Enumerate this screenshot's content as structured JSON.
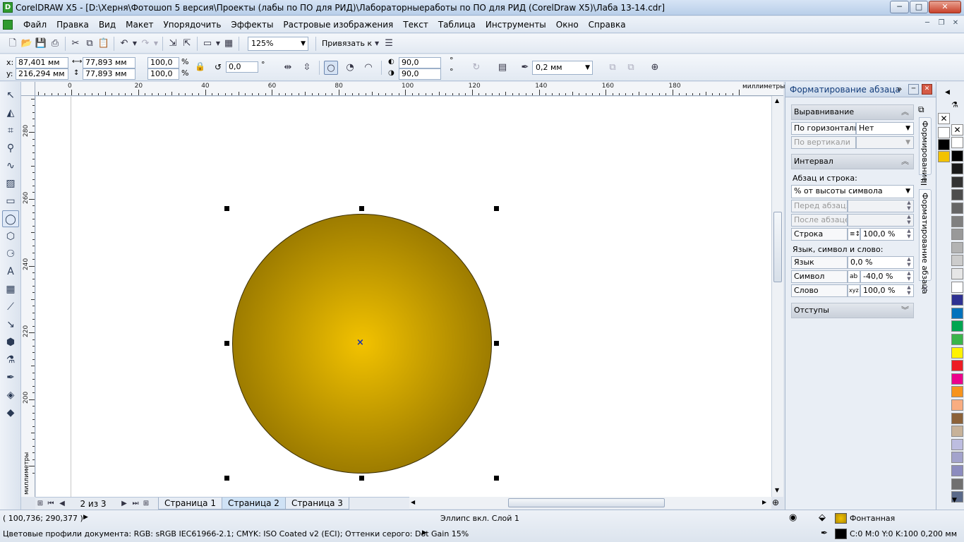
{
  "app": {
    "title": "CorelDRAW X5 - [D:\\Херня\\Фотошоп 5 версия\\Проекты (лабы по ПО для РИД)\\Лабораторныеработы по ПО для РИД (CorelDraw X5)\\Лаба 13-14.cdr]",
    "logo_letter": "D",
    "minimize": "─",
    "maximize": "□",
    "close": "✕"
  },
  "menu": {
    "items": [
      {
        "label": "Файл"
      },
      {
        "label": "Правка"
      },
      {
        "label": "Вид"
      },
      {
        "label": "Макет"
      },
      {
        "label": "Упорядочить"
      },
      {
        "label": "Эффекты"
      },
      {
        "label": "Растровые изображения"
      },
      {
        "label": "Текст"
      },
      {
        "label": "Таблица"
      },
      {
        "label": "Инструменты"
      },
      {
        "label": "Окно"
      },
      {
        "label": "Справка"
      }
    ],
    "mdi": {
      "minimize": "─",
      "restore": "❐",
      "close": "✕"
    }
  },
  "toolbar": {
    "zoom": "125%",
    "snap_label": "Привязать к"
  },
  "properties": {
    "x_label": "x:",
    "x": "87,401 мм",
    "y_label": "y:",
    "y": "216,294 мм",
    "width": "77,893 мм",
    "height": "77,893 мм",
    "scale_x": "100,0",
    "scale_y": "100,0",
    "percent": "%",
    "rotation": "0,0",
    "degree": "°",
    "start_angle": "90,0",
    "end_angle": "90,0",
    "outline_width": "0,2 мм"
  },
  "ruler": {
    "unit": "миллиметры",
    "h_ticks": [
      "0",
      "20",
      "40",
      "60",
      "80",
      "100",
      "120",
      "140",
      "160",
      "180"
    ],
    "v_ticks": [
      "280",
      "260",
      "240",
      "220",
      "200"
    ]
  },
  "canvas": {
    "fill_center": "#f2c200",
    "fill_edge": "#7a5f00",
    "selection_center": "×"
  },
  "pages": {
    "counter": "2 из 3",
    "tabs": [
      {
        "label": "Страница 1",
        "active": false
      },
      {
        "label": "Страница 2",
        "active": true
      },
      {
        "label": "Страница 3",
        "active": false
      }
    ]
  },
  "docker": {
    "title": "Форматирование абзаца",
    "alignment": {
      "header": "Выравнивание",
      "horizontal_label": "По горизонтали",
      "horizontal_value": "Нет",
      "vertical_label": "По вертикали"
    },
    "spacing": {
      "header": "Интервал",
      "para_line_label": "Абзац и строка:",
      "unit_value": "% от высоты символа",
      "before_label": "Перед абзац...",
      "after_label": "После абзацев",
      "line_label": "Строка",
      "line_value": "100,0 %",
      "lang_char_word_label": "Язык, символ и слово:",
      "language_label": "Язык",
      "language_value": "0,0 %",
      "char_label": "Символ",
      "char_value": "-40,0 %",
      "word_label": "Слово",
      "word_value": "100,0 %"
    },
    "indents": {
      "header": "Отступы"
    },
    "vtab_formatting": "Формирование",
    "vtab_paragraph": "Форматирование абзаца"
  },
  "palette": {
    "colors": [
      "#ffffff",
      "#000000",
      "#1a1a1a",
      "#333333",
      "#4d4d4d",
      "#666666",
      "#808080",
      "#999999",
      "#b3b3b3",
      "#cccccc",
      "#e6e6e6",
      "#ffffff",
      "#2e3192",
      "#0072bc",
      "#00a651",
      "#39b54a",
      "#fff200",
      "#ed1c24",
      "#ec008c",
      "#f7941d",
      "#f9ad81",
      "#8c6239",
      "#c7b299",
      "#bdbde0",
      "#a3a3cc",
      "#8c8cbf",
      "#707070",
      "#5a6a8a"
    ],
    "doc_colors": [
      "#ffffff",
      "#000000",
      "#f2c200"
    ]
  },
  "status": {
    "coords": "( 100,736; 290,377 )",
    "object": "Эллипс вкл. Слой 1",
    "fill_type": "Фонтанная",
    "outline": "C:0 M:0 Y:0 K:100  0,200 мм",
    "color_profiles": "Цветовые профили документа: RGB: sRGB IEC61966-2.1; CMYK: ISO Coated v2 (ECI); Оттенки серого: Dot Gain 15%",
    "fill_swatch_color": "#b08a00",
    "outline_swatch_color": "#000000"
  }
}
